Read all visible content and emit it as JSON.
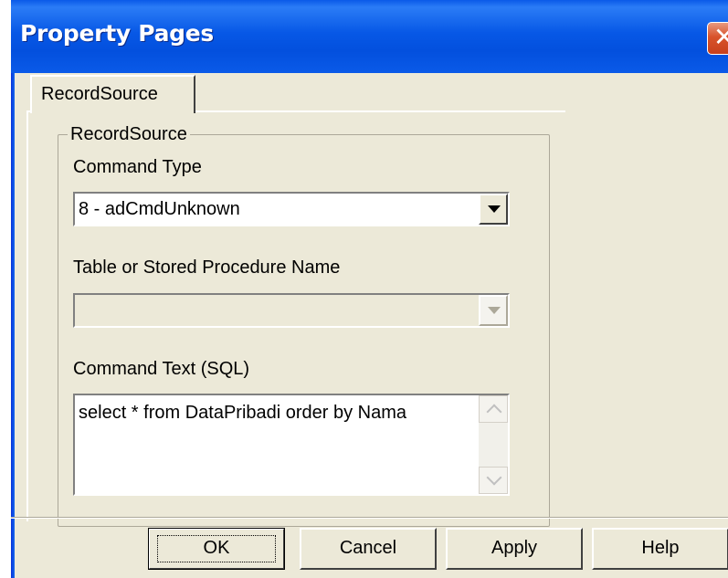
{
  "window": {
    "title": "Property Pages",
    "close_glyph": "✕",
    "close_icon": "close-icon"
  },
  "tabs": [
    {
      "label": "RecordSource",
      "selected": true
    }
  ],
  "group": {
    "legend": "RecordSource",
    "command_type": {
      "label": "Command Type",
      "value": "8 - adCmdUnknown",
      "enabled": true
    },
    "table_name": {
      "label": "Table or Stored Procedure Name",
      "value": "",
      "enabled": false
    },
    "command_text": {
      "label": "Command Text (SQL)",
      "value": "select * from DataPribadi order by Nama"
    }
  },
  "buttons": {
    "ok": "OK",
    "cancel": "Cancel",
    "apply": "Apply",
    "help": "Help"
  },
  "colors": {
    "titlebar": "#0a5ae8",
    "dialog_bg": "#ece9d8",
    "close_button": "#d8532b"
  }
}
